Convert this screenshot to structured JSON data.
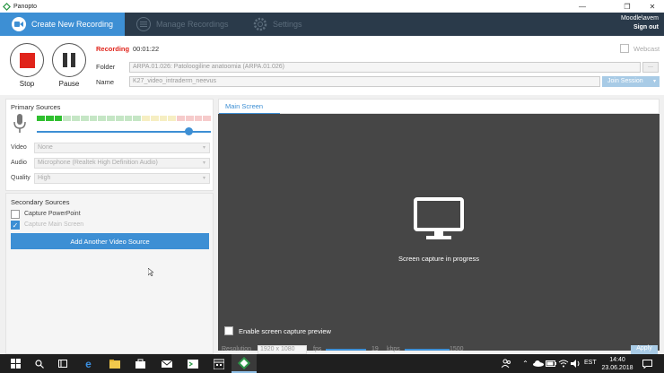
{
  "window": {
    "title": "Panopto",
    "minimize": "—",
    "restore": "❐",
    "close": "✕"
  },
  "nav": {
    "tabs": [
      {
        "label": "Create New Recording"
      },
      {
        "label": "Manage Recordings"
      },
      {
        "label": "Settings"
      }
    ],
    "user": "Moodle\\avem",
    "signout": "Sign out"
  },
  "controls": {
    "stop_label": "Stop",
    "pause_label": "Pause",
    "status": "Recording",
    "elapsed": "00:01:22",
    "webcast_label": "Webcast",
    "folder_label": "Folder",
    "folder_value": "ARPA.01.026: Patoloogiline anatoomia (ARPA.01.026)",
    "name_label": "Name",
    "name_value": "K27_video_intraderm_neevus",
    "join_session": "Join Session"
  },
  "primary": {
    "title": "Primary Sources",
    "audio_level": 0.15,
    "volume_slider": 0.87,
    "video_label": "Video",
    "video_value": "None",
    "audio_label": "Audio",
    "audio_value": "Microphone (Realtek High Definition Audio)",
    "quality_label": "Quality",
    "quality_value": "High"
  },
  "secondary": {
    "title": "Secondary Sources",
    "capture_powerpoint": "Capture PowerPoint",
    "capture_main_screen": "Capture Main Screen",
    "add_video_source": "Add Another Video Source"
  },
  "main": {
    "tab": "Main Screen",
    "message": "Screen capture in progress",
    "preview_label": "Enable screen capture preview"
  },
  "bottom": {
    "resolution_label": "Resolution",
    "resolution_value": "1920 x 1080",
    "fps_label": "fps",
    "fps_value": "19",
    "kbps_label": "kbps",
    "kbps_value": "1500",
    "apply": "Apply"
  },
  "taskbar": {
    "time": "14:40",
    "date": "23.06.2018",
    "lang": "EST"
  },
  "colors": {
    "accent": "#3d8fd4",
    "nav_bg": "#2a3a4a",
    "record": "#e0241b"
  }
}
